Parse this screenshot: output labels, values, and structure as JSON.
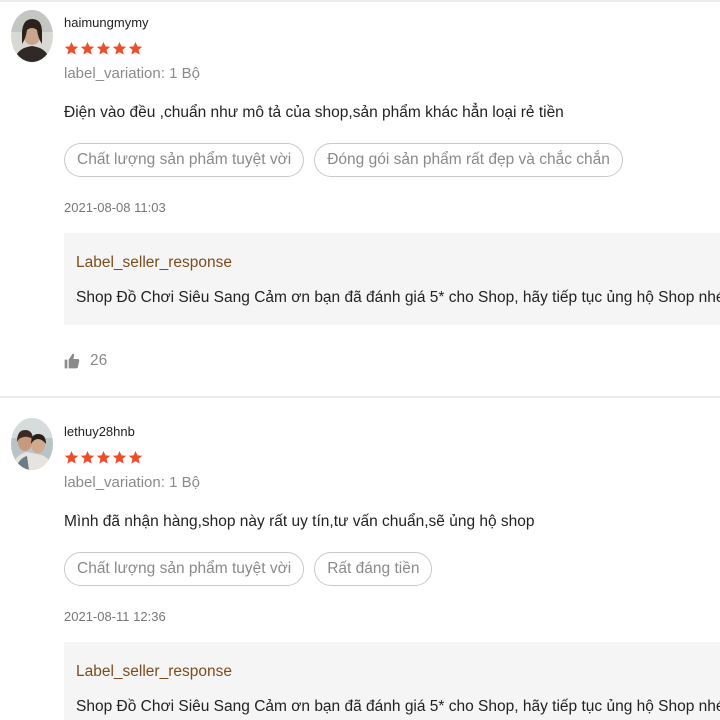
{
  "reviews": [
    {
      "username": "haimungmymy",
      "rating": 5,
      "variation": "label_variation: 1 Bộ",
      "comment": "Điện vào đều ,chuẩn như mô tả của shop,sản phẩm khác hẳn loại rẻ tiền",
      "tags": [
        "Chất lượng sản phẩm tuyệt vời",
        "Đóng gói sản phẩm rất đẹp và chắc chắn"
      ],
      "date": "2021-08-08 11:03",
      "response_label": "Label_seller_response",
      "response_text": "Shop Đồ Chơi Siêu Sang Cảm ơn bạn đã đánh giá 5* cho Shop, hãy tiếp tục ủng hộ Shop nhé",
      "likes": "26"
    },
    {
      "username": "lethuy28hnb",
      "rating": 5,
      "variation": "label_variation: 1 Bộ",
      "comment": "Mình đã nhận hàng,shop này rất uy tín,tư vấn chuẩn,sẽ ủng hộ shop",
      "tags": [
        "Chất lượng sản phẩm tuyệt vời",
        "Rất đáng tiền"
      ],
      "date": "2021-08-11 12:36",
      "response_label": "Label_seller_response",
      "response_text": "Shop Đồ Chơi Siêu Sang Cảm ơn bạn đã đánh giá 5* cho Shop, hãy tiếp tục ủng hộ Shop nhé"
    }
  ],
  "colors": {
    "star": "#ee4d2d",
    "heart": "#e0245e",
    "seller_label": "#7a4d1f"
  },
  "icons": {
    "rating": "star-icon",
    "like": "thumbs-up-icon",
    "emoji": "red-heart-icon"
  }
}
